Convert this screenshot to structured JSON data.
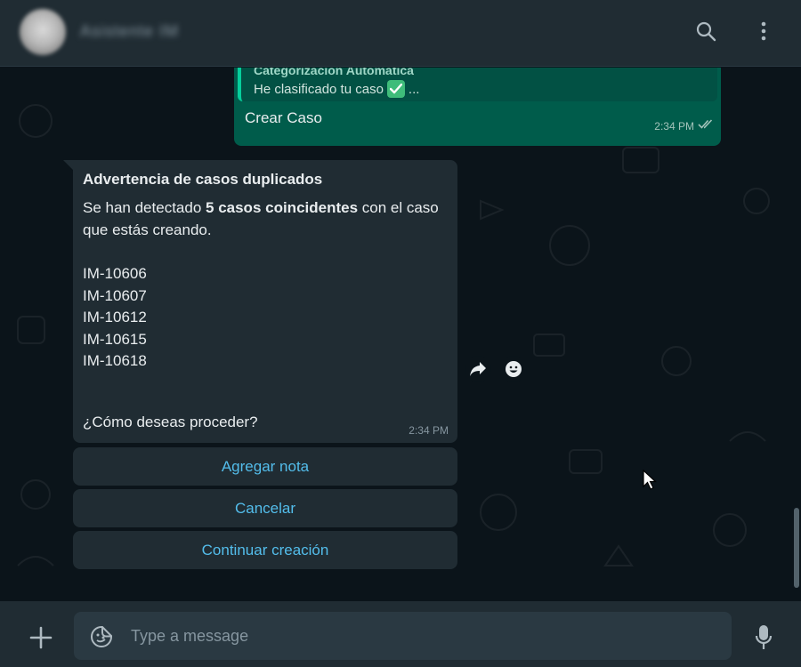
{
  "header": {
    "contact_name": "Asistente IM",
    "search_icon": "search-icon",
    "menu_icon": "more-vertical-icon"
  },
  "outgoing": {
    "quote_title": "Categorización Automática",
    "quote_text": "He clasificado tu caso",
    "quote_suffix": "...",
    "text": "Crear Caso",
    "time": "2:34 PM",
    "status_icon": "double-check-icon"
  },
  "incoming": {
    "title": "Advertencia de casos duplicados",
    "body_prefix": "Se han detectado ",
    "body_bold": "5 casos coincidentes",
    "body_suffix": " con el caso que estás creando.",
    "cases": [
      "IM-10606",
      "IM-10607",
      "IM-10612",
      "IM-10615",
      "IM-10618"
    ],
    "question": "¿Cómo deseas proceder?",
    "time": "2:34 PM"
  },
  "replies": [
    "Agregar nota",
    "Cancelar",
    "Continuar creación"
  ],
  "hover_actions": [
    "forward-icon",
    "emoji-icon"
  ],
  "composer": {
    "placeholder": "Type a message",
    "value": ""
  },
  "colors": {
    "header_bg": "#202c33",
    "chat_bg": "#0b141a",
    "outgoing_bubble": "#005c4b",
    "incoming_bubble": "#202c33",
    "link_blue": "#53bdeb"
  }
}
